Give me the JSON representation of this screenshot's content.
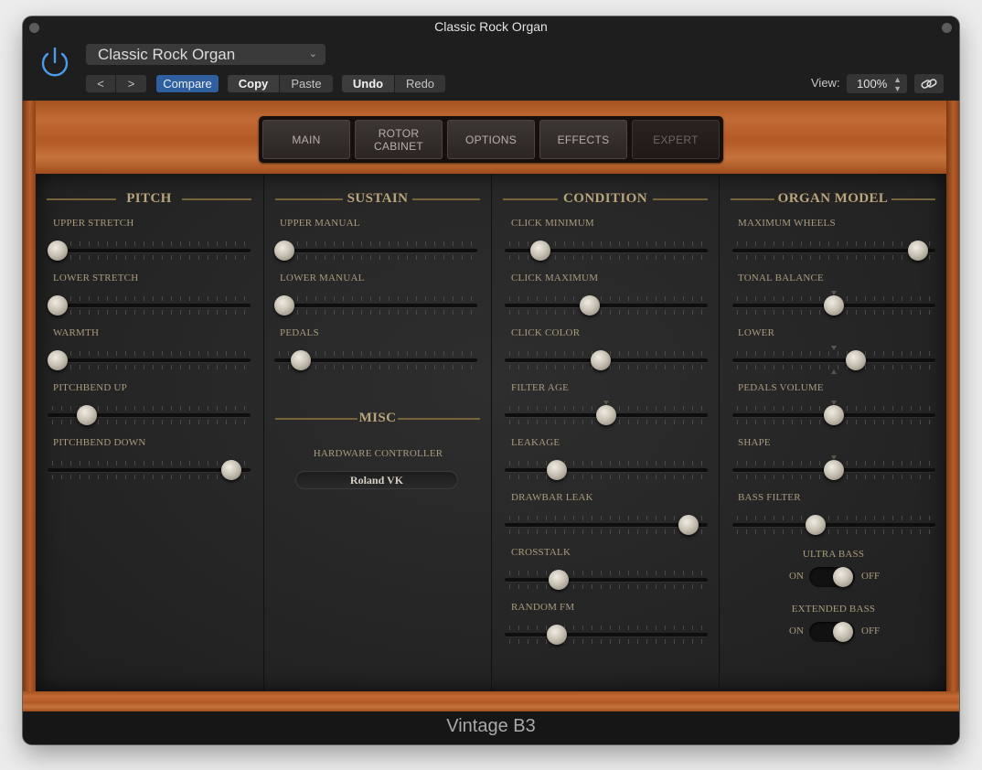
{
  "window": {
    "title": "Classic Rock Organ",
    "preset_name": "Classic Rock Organ",
    "toolbar": {
      "prev_label": "<",
      "next_label": ">",
      "compare_label": "Compare",
      "copy_label": "Copy",
      "paste_label": "Paste",
      "undo_label": "Undo",
      "redo_label": "Redo",
      "view_label": "View:",
      "zoom_value": "100%"
    },
    "footer_title": "Vintage B3"
  },
  "tabs": [
    {
      "label": "MAIN",
      "active": false
    },
    {
      "label": "ROTOR CABINET",
      "active": false
    },
    {
      "label": "OPTIONS",
      "active": false
    },
    {
      "label": "EFFECTS",
      "active": false
    },
    {
      "label": "EXPERT",
      "active": true
    }
  ],
  "sections": {
    "pitch": {
      "title": "PITCH",
      "params": [
        {
          "label": "UPPER STRETCH",
          "value": 0.0
        },
        {
          "label": "LOWER STRETCH",
          "value": 0.0
        },
        {
          "label": "WARMTH",
          "value": 0.0
        },
        {
          "label": "PITCHBEND UP",
          "value": 0.16
        },
        {
          "label": "PITCHBEND DOWN",
          "value": 0.95
        }
      ]
    },
    "sustain": {
      "title": "SUSTAIN",
      "params": [
        {
          "label": "UPPER MANUAL",
          "value": 0.0
        },
        {
          "label": "LOWER MANUAL",
          "value": 0.0
        },
        {
          "label": "PEDALS",
          "value": 0.09
        }
      ]
    },
    "misc": {
      "title": "MISC",
      "controller_label": "HARDWARE CONTROLLER",
      "controller_value": "Roland VK"
    },
    "condition": {
      "title": "CONDITION",
      "params": [
        {
          "label": "CLICK MINIMUM",
          "value": 0.14
        },
        {
          "label": "CLICK MAXIMUM",
          "value": 0.41
        },
        {
          "label": "CLICK COLOR",
          "value": 0.47
        },
        {
          "label": "FILTER AGE",
          "value": 0.5,
          "mark": true
        },
        {
          "label": "LEAKAGE",
          "value": 0.23
        },
        {
          "label": "DRAWBAR LEAK",
          "value": 0.95
        },
        {
          "label": "CROSSTALK",
          "value": 0.24
        },
        {
          "label": "RANDOM FM",
          "value": 0.23
        }
      ]
    },
    "organ_model": {
      "title": "ORGAN MODEL",
      "params": [
        {
          "label": "MAXIMUM WHEELS",
          "value": 0.96
        },
        {
          "label": "TONAL BALANCE",
          "value": 0.5,
          "mark": true
        },
        {
          "label": "LOWER",
          "value": 0.62,
          "mark": true,
          "mark_pos": 0.5
        },
        {
          "label": "PEDALS VOLUME",
          "value": 0.5,
          "mark": true
        },
        {
          "label": "SHAPE",
          "value": 0.5,
          "mark": true
        },
        {
          "label": "BASS FILTER",
          "value": 0.4
        }
      ],
      "toggles": [
        {
          "label": "ULTRA BASS",
          "on_label": "ON",
          "off_label": "OFF",
          "state": "on"
        },
        {
          "label": "EXTENDED BASS",
          "on_label": "ON",
          "off_label": "OFF",
          "state": "on"
        }
      ]
    }
  },
  "colors": {
    "accent_compare": "#2f5f9f",
    "power_icon": "#4b9bea",
    "wood": "#b65e2a",
    "label_gold": "#b8a57a"
  }
}
